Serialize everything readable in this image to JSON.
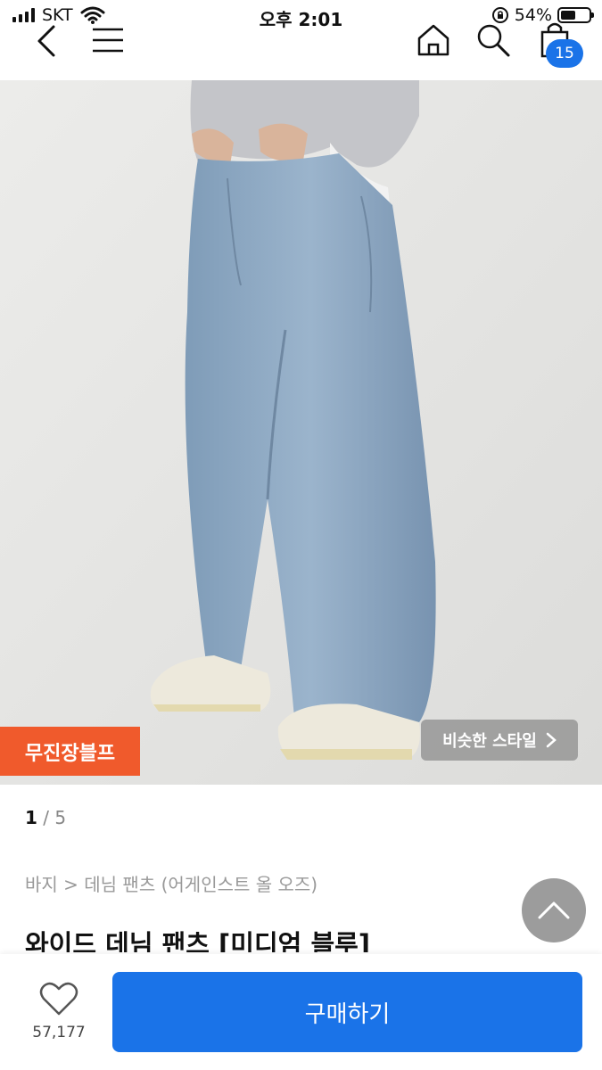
{
  "status": {
    "carrier": "SKT",
    "time": "오후 2:01",
    "battery": "54%",
    "battery_level": 0.54
  },
  "nav": {
    "cart_count": "15"
  },
  "hero": {
    "brand_tag": "무진장블프",
    "similar_style": "비슷한 스타일"
  },
  "pager": {
    "current": "1",
    "total": "/ 5"
  },
  "breadcrumb": "바지 > 데님 팬츠 (어게인스트 올 오즈)",
  "product": {
    "title": "와이드 데님 팬츠 [미디엄 블루]"
  },
  "bottom": {
    "likes": "57,177",
    "buy_label": "구매하기"
  },
  "colors": {
    "accent": "#1a73e8",
    "tag": "#f05a2c"
  }
}
